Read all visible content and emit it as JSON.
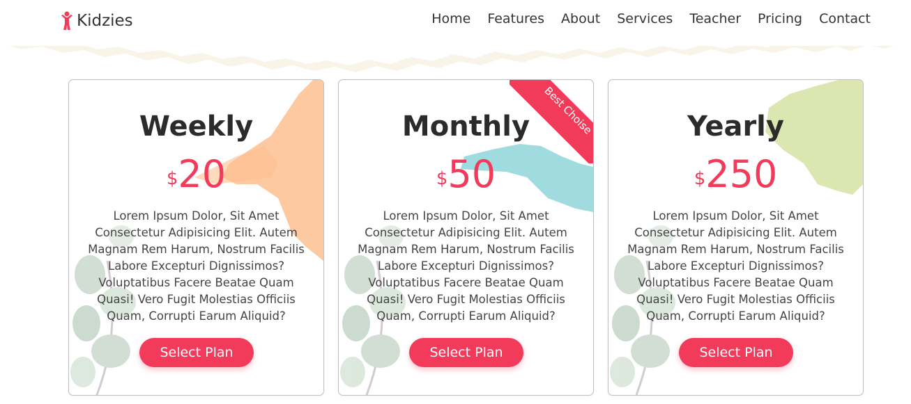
{
  "brand": {
    "name": "Kidzies",
    "icon": "child-figure-icon"
  },
  "nav": [
    "Home",
    "Features",
    "About",
    "Services",
    "Teacher",
    "Pricing",
    "Contact"
  ],
  "plans": [
    {
      "name": "Weekly",
      "currency": "$",
      "amount": "20",
      "description": "Lorem Ipsum Dolor, Sit Amet Consectetur Adipisicing Elit. Autem Magnam Rem Harum, Nostrum Facilis Labore Excepturi Dignissimos? Voluptatibus Facere Beatae Quam Quasi! Vero Fugit Molestias Officiis Quam, Corrupti Earum Aliquid?",
      "button": "Select Plan",
      "splash_color": "#fdbf8f"
    },
    {
      "name": "Monthly",
      "currency": "$",
      "amount": "50",
      "description": "Lorem Ipsum Dolor, Sit Amet Consectetur Adipisicing Elit. Autem Magnam Rem Harum, Nostrum Facilis Labore Excepturi Dignissimos? Voluptatibus Facere Beatae Quam Quasi! Vero Fugit Molestias Officiis Quam, Corrupti Earum Aliquid?",
      "button": "Select Plan",
      "badge": "Best Choise",
      "splash_color": "#8fd6d9"
    },
    {
      "name": "Yearly",
      "currency": "$",
      "amount": "250",
      "description": "Lorem Ipsum Dolor, Sit Amet Consectetur Adipisicing Elit. Autem Magnam Rem Harum, Nostrum Facilis Labore Excepturi Dignissimos? Voluptatibus Facere Beatae Quam Quasi! Vero Fugit Molestias Officiis Quam, Corrupti Earum Aliquid?",
      "button": "Select Plan",
      "splash_color": "#d6e2a3"
    }
  ],
  "colors": {
    "accent": "#f23a5b",
    "text": "#333333",
    "leaf": "#9cb7a0"
  }
}
